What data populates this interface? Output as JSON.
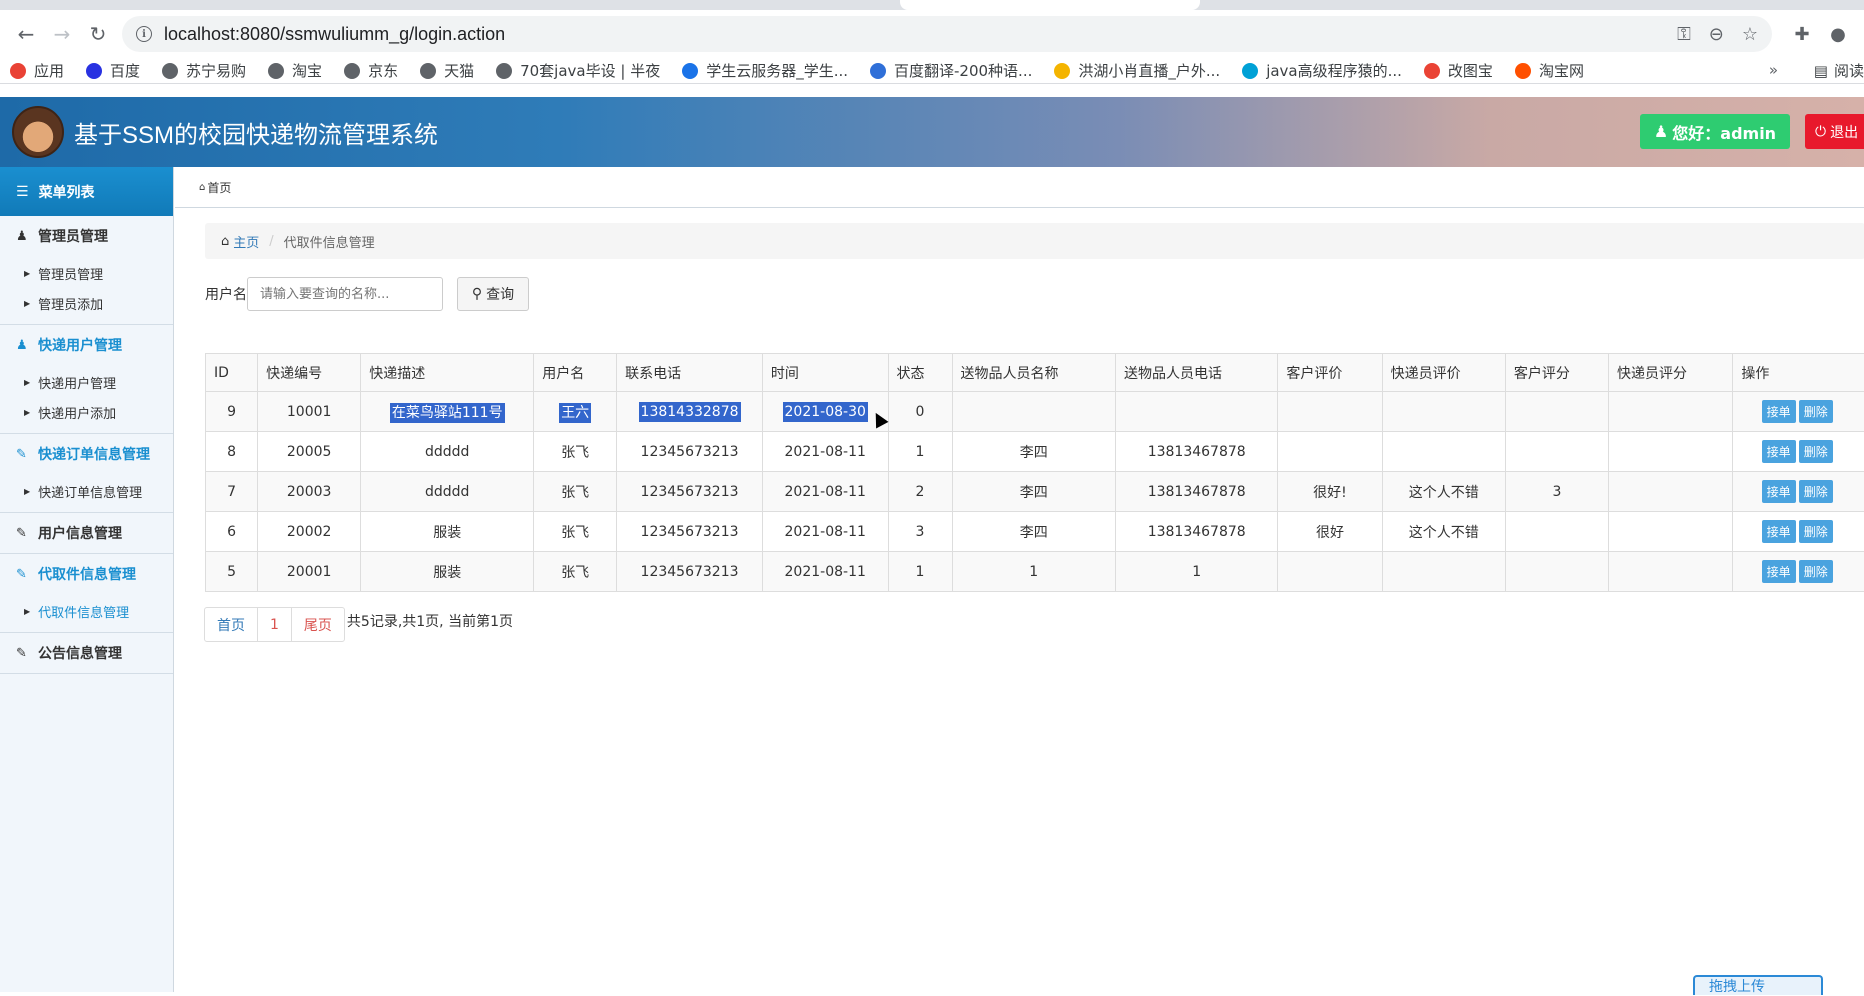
{
  "browser": {
    "url": "localhost:8080/ssmwuliumm_g/login.action",
    "bookmarks": [
      {
        "label": "应用",
        "color": "#e94235"
      },
      {
        "label": "百度",
        "color": "#2932e1"
      },
      {
        "label": "苏宁易购",
        "color": "#5f6368"
      },
      {
        "label": "淘宝",
        "color": "#5f6368"
      },
      {
        "label": "京东",
        "color": "#5f6368"
      },
      {
        "label": "天猫",
        "color": "#5f6368"
      },
      {
        "label": "70套java毕设 | 半夜",
        "color": "#5f6368"
      },
      {
        "label": "学生云服务器_学生...",
        "color": "#1a73e8"
      },
      {
        "label": "百度翻译-200种语...",
        "color": "#2f6fd8"
      },
      {
        "label": "洪湖小肖直播_户外...",
        "color": "#f4b400"
      },
      {
        "label": "java高级程序猿的...",
        "color": "#00a1d6"
      },
      {
        "label": "改图宝",
        "color": "#ea4335"
      },
      {
        "label": "淘宝网",
        "color": "#ff5000"
      }
    ],
    "more": "»",
    "reading_list": "阅读"
  },
  "header": {
    "title": "基于SSM的校园快递物流管理系统",
    "hello": "您好：admin",
    "logout": "退出"
  },
  "sidebar": {
    "title": "菜单列表",
    "groups": [
      {
        "title": "管理员管理",
        "items": [
          "管理员管理",
          "管理员添加"
        ]
      },
      {
        "title": "快递用户管理",
        "items": [
          "快递用户管理",
          "快递用户添加"
        ]
      },
      {
        "title": "快递订单信息管理",
        "items": [
          "快递订单信息管理"
        ]
      },
      {
        "title": "用户信息管理",
        "items": []
      },
      {
        "title": "代取件信息管理",
        "items": [
          "代取件信息管理"
        ]
      },
      {
        "title": "公告信息管理",
        "items": []
      }
    ]
  },
  "main": {
    "top_crumb": "首页",
    "breadcrumb_home": "主页",
    "breadcrumb_current": "代取件信息管理",
    "search_label": "用户名",
    "search_placeholder": "请输入要查询的名称...",
    "search_button": "查询",
    "columns": [
      "ID",
      "快递编号",
      "快递描述",
      "用户名",
      "联系电话",
      "时间",
      "状态",
      "送物品人员名称",
      "送物品人员电话",
      "客户评价",
      "快递员评价",
      "客户评分",
      "快递员评分",
      "操作"
    ],
    "rows": [
      [
        "9",
        "10001",
        "在菜鸟驿站111号",
        "王六",
        "13814332878",
        "2021-08-30",
        "0",
        "",
        "",
        "",
        "",
        "",
        ""
      ],
      [
        "8",
        "20005",
        "ddddd",
        "张飞",
        "12345673213",
        "2021-08-11",
        "1",
        "李四",
        "13813467878",
        "",
        "",
        "",
        ""
      ],
      [
        "7",
        "20003",
        "ddddd",
        "张飞",
        "12345673213",
        "2021-08-11",
        "2",
        "李四",
        "13813467878",
        "很好!",
        "这个人不错",
        "3",
        ""
      ],
      [
        "6",
        "20002",
        "服装",
        "张飞",
        "12345673213",
        "2021-08-11",
        "3",
        "李四",
        "13813467878",
        "很好",
        "这个人不错",
        "",
        ""
      ],
      [
        "5",
        "20001",
        "服装",
        "张飞",
        "12345673213",
        "2021-08-11",
        "1",
        "1",
        "1",
        "",
        "",
        "",
        ""
      ]
    ],
    "op_accept": "接单",
    "op_delete": "删除",
    "pager": {
      "first": "首页",
      "page": "1",
      "last": "尾页",
      "info": "共5记录,共1页, 当前第1页"
    },
    "upload": "拖拽上传"
  }
}
